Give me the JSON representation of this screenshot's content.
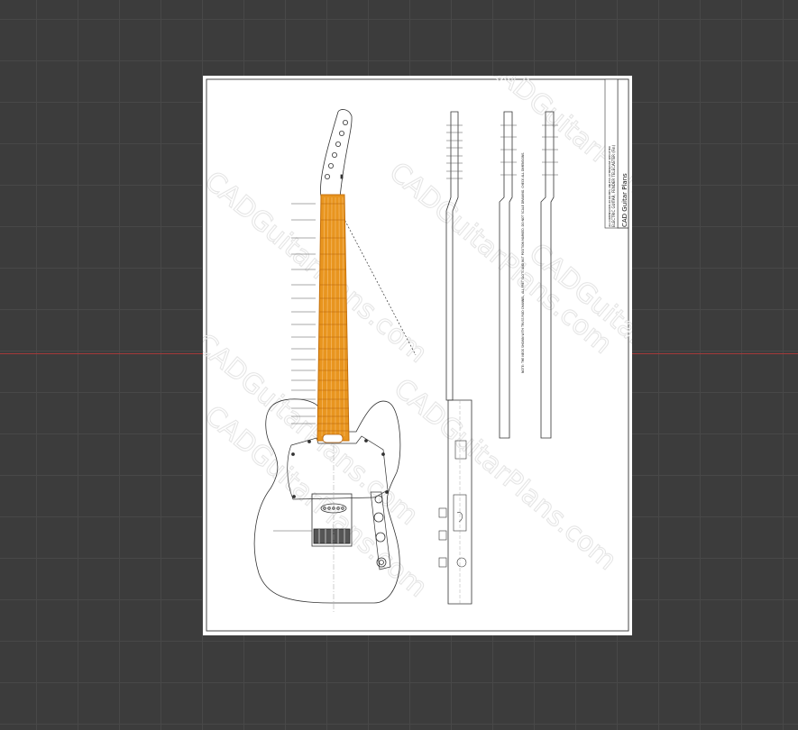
{
  "viewport": {
    "background": "#3c3c3c",
    "grid_color": "#484848",
    "axis_color": "#a33a3a"
  },
  "sheet": {
    "background": "#ffffff",
    "watermark_text": "CADGuitarPlans.com",
    "title_block": {
      "company": "CAD Guitar Plans",
      "drawing_title": "ELECTRIC GUITAR, FENDER TELECASTER (Fin)",
      "notes": "ALL DIMENSIONS IN INCHES UNLESS OTHERWISE SPECIFIED"
    },
    "notes_text": "NOTE: THE NECK SHOWN WITH TRUSS ROD CHANNEL, ALL FRET SLOTS AND NUT POSITION MARKED. DO NOT SCALE DRAWING. CHECK ALL DIMENSIONS."
  },
  "selection": {
    "highlight_color": "#e8951f",
    "selected_object": "neck"
  }
}
